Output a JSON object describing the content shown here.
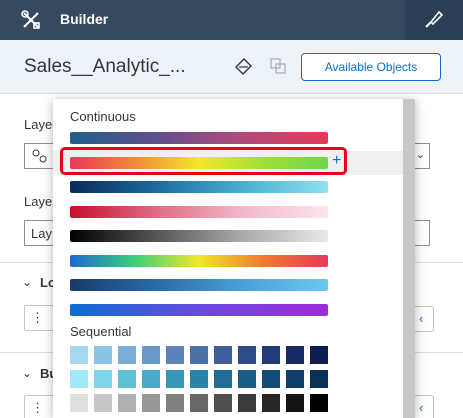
{
  "topbar": {
    "title": "Builder",
    "tools_icon": "tools-icon",
    "right_icon": "paint-brush-icon"
  },
  "header": {
    "doc_title": "Sales__Analytic_...",
    "available_objects_label": "Available Objects"
  },
  "panel": {
    "label1": "Laye",
    "label2": "Laye",
    "field2_value": "Lay",
    "section1": "Lo",
    "section2": "Bu"
  },
  "palette": {
    "continuous_label": "Continuous",
    "sequential_label": "Sequential",
    "continuous": [
      {
        "gradient": "linear-gradient(to right, #1f5f8b, #5e4f8a, #b04a7a, #e8385a)"
      },
      {
        "gradient": "linear-gradient(to right, #e8385a, #f08a3a, #f5e62a, #9fe03a, #6fd64a)",
        "selected": true
      },
      {
        "gradient": "linear-gradient(to right, #0b2a5a, #1a6aa0, #4aaed0, #8ee0f0)"
      },
      {
        "gradient": "linear-gradient(to right, #c8102e, #e06a84, #f2b8c8, #fbe4ec)"
      },
      {
        "gradient": "linear-gradient(to right, #000000, #555555, #aaaaaa, #e8e8e8)"
      },
      {
        "gradient": "linear-gradient(to right, #1a6ad0, #3ad07a, #f0e82a, #f07a2a, #e8385a)"
      },
      {
        "gradient": "linear-gradient(to right, #173a6a, #2a6aa8, #4aa0d8, #6ac8f0)"
      },
      {
        "gradient": "linear-gradient(to right, #0a6ed1, #6a4ae0, #a02ad8)"
      }
    ],
    "sequential": [
      [
        "#a8d8f0",
        "#8cc4e6",
        "#7aaed8",
        "#6a98c8",
        "#5a84b8",
        "#4a70a8",
        "#3d5e98",
        "#304c88",
        "#233a78",
        "#182a66",
        "#0e1c50"
      ],
      [
        "#9ee8f8",
        "#7ed4e8",
        "#60c0d8",
        "#4aaac8",
        "#3896b8",
        "#2a82a8",
        "#206e98",
        "#1a5c88",
        "#144c78",
        "#0f3e68",
        "#0a3058"
      ],
      [
        "#e0e0e0",
        "#c8c8c8",
        "#b0b0b0",
        "#989898",
        "#808080",
        "#686868",
        "#505050",
        "#3a3a3a",
        "#262626",
        "#141414",
        "#000000"
      ]
    ]
  }
}
